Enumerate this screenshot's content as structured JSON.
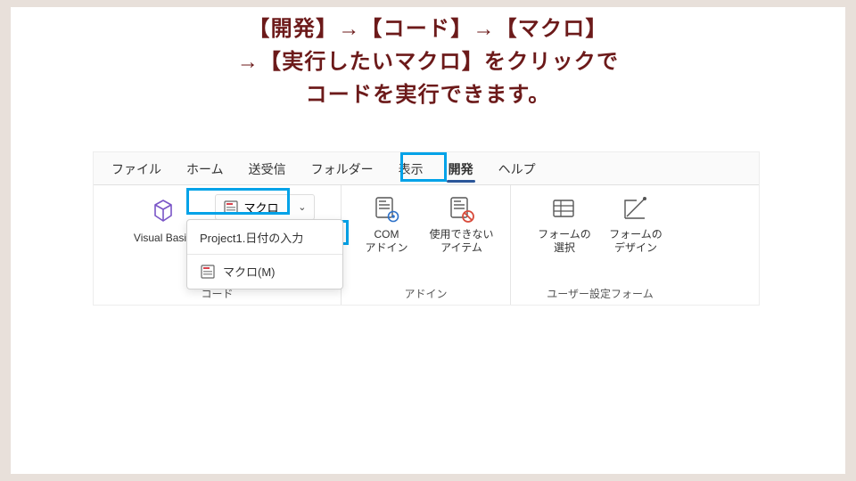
{
  "instruction": {
    "line1": "【開発】→【コード】→【マクロ】",
    "line2": "→【実行したいマクロ】をクリックで",
    "line3": "コードを実行できます。"
  },
  "tabs": {
    "file": "ファイル",
    "home": "ホーム",
    "sendrecv": "送受信",
    "folder": "フォルダー",
    "view": "表示",
    "developer": "開発",
    "help": "ヘルプ"
  },
  "groups": {
    "code": {
      "label": "コード",
      "visual_basic": "Visual Basic",
      "macro_button": "マクロ",
      "menu": {
        "item1": "Project1.日付の入力",
        "item2": "マクロ(M)"
      }
    },
    "addins": {
      "label": "アドイン",
      "com_addins_l1": "COM",
      "com_addins_l2": "アドイン",
      "disabled_l1": "使用できない",
      "disabled_l2": "アイテム"
    },
    "forms": {
      "label": "ユーザー設定フォーム",
      "choose_l1": "フォームの",
      "choose_l2": "選択",
      "design_l1": "フォームの",
      "design_l2": "デザイン"
    }
  }
}
